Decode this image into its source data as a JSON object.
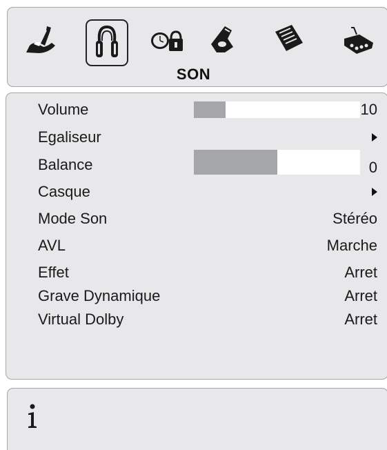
{
  "menu": {
    "title": "SON",
    "icons": [
      "picture-icon",
      "sound-icon",
      "timer-icon",
      "lock-icon",
      "setup-icon",
      "source-icon"
    ],
    "selected_icon": "sound-icon"
  },
  "items": [
    {
      "label": "Volume",
      "value": "10",
      "slider_fraction": 0.19
    },
    {
      "label": "Egaliseur",
      "value": "",
      "has_submenu": true
    },
    {
      "label": "Balance",
      "value": "0",
      "slider_fraction": 0.5
    },
    {
      "label": "Casque",
      "value": "",
      "has_submenu": true
    },
    {
      "label": "Mode Son",
      "value": "Stéréo"
    },
    {
      "label": "AVL",
      "value": "Marche"
    },
    {
      "label": "Effet",
      "value": "Arret"
    },
    {
      "label": "Grave Dynamique",
      "value": "Arret"
    },
    {
      "label": "Virtual Dolby",
      "value": "Arret"
    }
  ],
  "info": {
    "icon": "info-icon"
  },
  "colors": {
    "panel": "#e8e8ea",
    "slider_fill": "#a5a6aa",
    "slider_track": "#ffffff"
  }
}
